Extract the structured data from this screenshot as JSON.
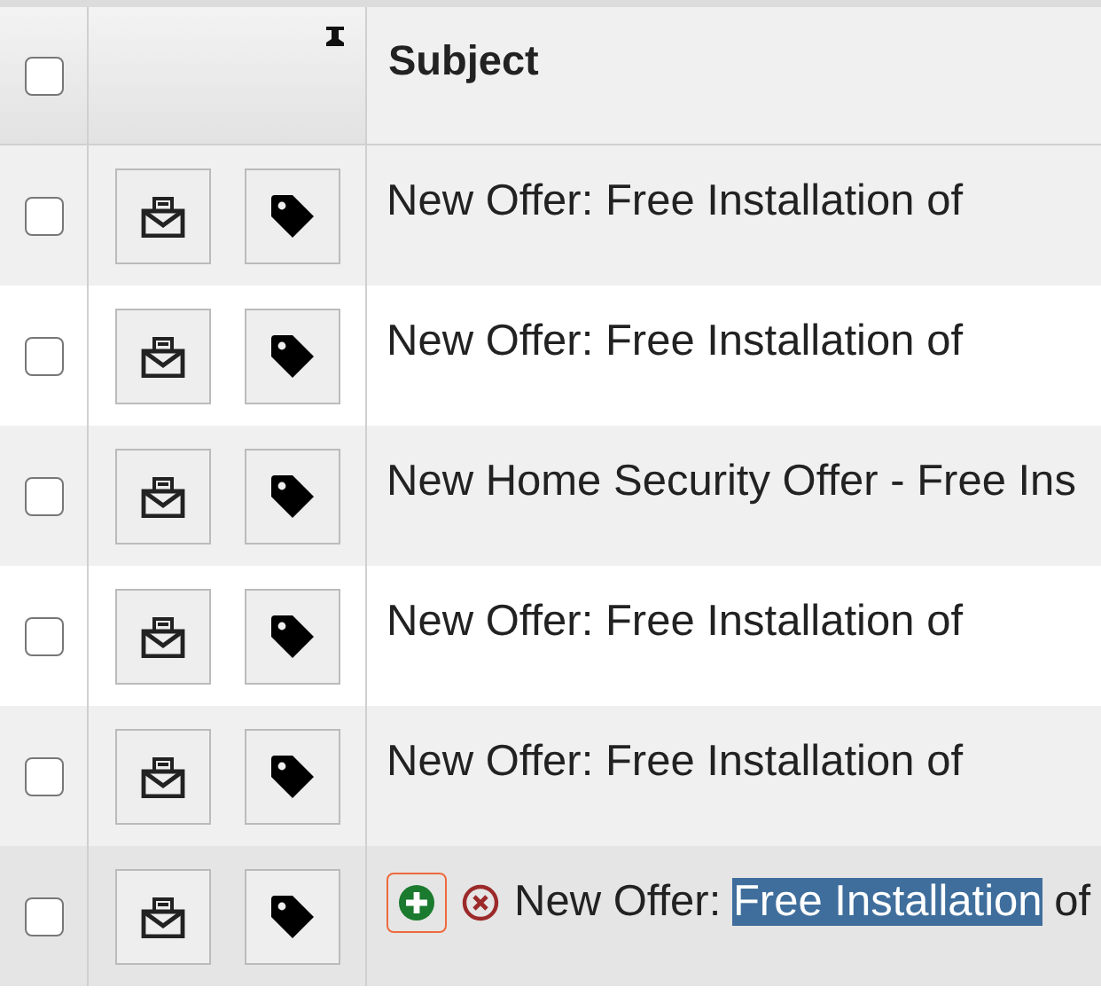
{
  "header": {
    "select_all_checked": false,
    "subject_label": "Subject",
    "pinned": true
  },
  "rows": [
    {
      "checked": false,
      "hovered": false,
      "subject": [
        {
          "text": "New Offer: Free Installation of",
          "highlighted": false
        }
      ]
    },
    {
      "checked": false,
      "hovered": false,
      "subject": [
        {
          "text": "New Offer: Free Installation of",
          "highlighted": false
        }
      ]
    },
    {
      "checked": false,
      "hovered": false,
      "subject": [
        {
          "text": "New Home Security Offer - Free Ins",
          "highlighted": false
        }
      ]
    },
    {
      "checked": false,
      "hovered": false,
      "subject": [
        {
          "text": "New Offer: Free Installation of",
          "highlighted": false
        }
      ]
    },
    {
      "checked": false,
      "hovered": false,
      "subject": [
        {
          "text": "New Offer: Free Installation of",
          "highlighted": false
        }
      ]
    },
    {
      "checked": false,
      "hovered": true,
      "subject": [
        {
          "text": "New Offer: ",
          "highlighted": false
        },
        {
          "text": "Free Installation",
          "highlighted": true
        },
        {
          "text": " of",
          "highlighted": false
        }
      ]
    }
  ]
}
